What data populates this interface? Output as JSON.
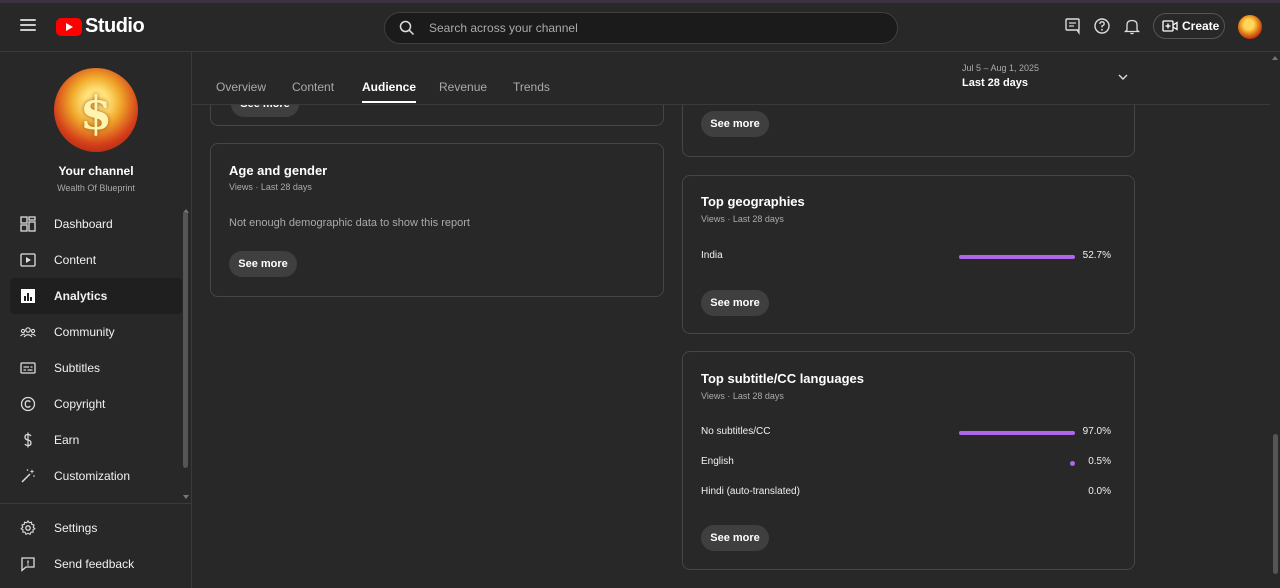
{
  "header": {
    "app_name": "Studio",
    "search_placeholder": "Search across your channel",
    "create_label": "Create"
  },
  "sidebar": {
    "channel_title": "Your channel",
    "channel_name": "Wealth Of Blueprint",
    "avatar_glyph": "$",
    "items": [
      {
        "label": "Dashboard",
        "icon": "dashboard-icon"
      },
      {
        "label": "Content",
        "icon": "content-icon"
      },
      {
        "label": "Analytics",
        "icon": "analytics-icon",
        "active": true
      },
      {
        "label": "Community",
        "icon": "community-icon"
      },
      {
        "label": "Subtitles",
        "icon": "subtitles-icon"
      },
      {
        "label": "Copyright",
        "icon": "copyright-icon"
      },
      {
        "label": "Earn",
        "icon": "earn-icon"
      },
      {
        "label": "Customization",
        "icon": "customization-icon"
      }
    ],
    "footer_items": [
      {
        "label": "Settings",
        "icon": "gear-icon"
      },
      {
        "label": "Send feedback",
        "icon": "feedback-icon"
      }
    ]
  },
  "tabs": [
    "Overview",
    "Content",
    "Audience",
    "Revenue",
    "Trends"
  ],
  "active_tab": "Audience",
  "date_range": {
    "range": "Jul 5 – Aug 1, 2025",
    "label": "Last 28 days"
  },
  "cards": {
    "see_more_label": "See more",
    "age_gender": {
      "title": "Age and gender",
      "subtitle": "Views · Last 28 days",
      "message": "Not enough demographic data to show this report"
    },
    "geographies": {
      "title": "Top geographies",
      "subtitle": "Views · Last 28 days",
      "rows": [
        {
          "label": "India",
          "value": "52.7%",
          "fraction": 1.0
        }
      ]
    },
    "subtitle_languages": {
      "title": "Top subtitle/CC languages",
      "subtitle": "Views · Last 28 days",
      "rows": [
        {
          "label": "No subtitles/CC",
          "value": "97.0%",
          "fraction": 1.0
        },
        {
          "label": "English",
          "value": "0.5%",
          "fraction": 0.005
        },
        {
          "label": "Hindi (auto-translated)",
          "value": "0.0%",
          "fraction": 0.0
        }
      ]
    }
  },
  "colors": {
    "bar": "#b066e8",
    "brand": "#ff0000"
  }
}
